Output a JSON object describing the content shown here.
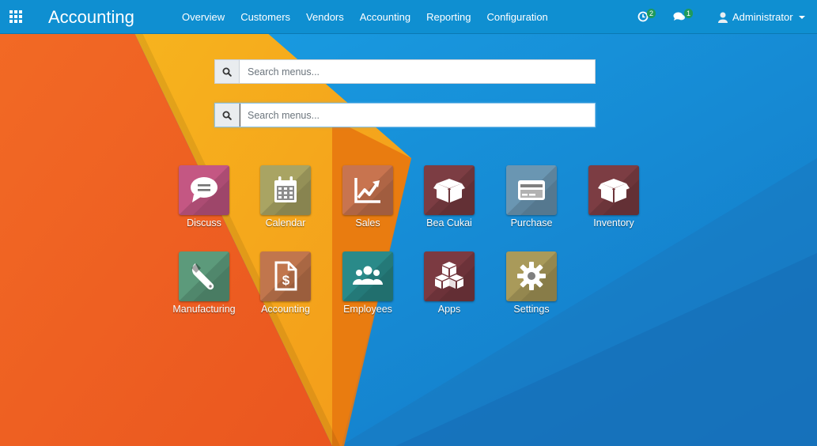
{
  "navbar": {
    "brand": "Accounting",
    "menu": [
      "Overview",
      "Customers",
      "Vendors",
      "Accounting",
      "Reporting",
      "Configuration"
    ],
    "activities_count": "2",
    "messages_count": "1",
    "user_name": "Administrator"
  },
  "search": {
    "placeholder_primary": "Search menus...",
    "placeholder_secondary": "Search menus..."
  },
  "apps": [
    {
      "label": "Discuss",
      "icon": "speech-bubble-icon",
      "color": "#c45783"
    },
    {
      "label": "Calendar",
      "icon": "calendar-icon",
      "color": "#a9a463"
    },
    {
      "label": "Sales",
      "icon": "chart-line-icon",
      "color": "#c8744f"
    },
    {
      "label": "Bea Cukai",
      "icon": "box-icon",
      "color": "#7c3d43"
    },
    {
      "label": "Purchase",
      "icon": "credit-card-icon",
      "color": "#6a96b2"
    },
    {
      "label": "Inventory",
      "icon": "box-icon",
      "color": "#7c3d43"
    },
    {
      "label": "Manufacturing",
      "icon": "wrench-icon",
      "color": "#5c9a7b"
    },
    {
      "label": "Accounting",
      "icon": "invoice-dollar-icon",
      "color": "#c1764d"
    },
    {
      "label": "Employees",
      "icon": "users-icon",
      "color": "#2a8a89"
    },
    {
      "label": "Apps",
      "icon": "cubes-icon",
      "color": "#7b3a41"
    },
    {
      "label": "Settings",
      "icon": "gear-icon",
      "color": "#a99a5a"
    }
  ],
  "colors": {
    "navbar": "#0f8fd1",
    "background_blue": "#1a8fd8",
    "background_orange": "#ee5d22",
    "background_yellow": "#f6a81c"
  }
}
